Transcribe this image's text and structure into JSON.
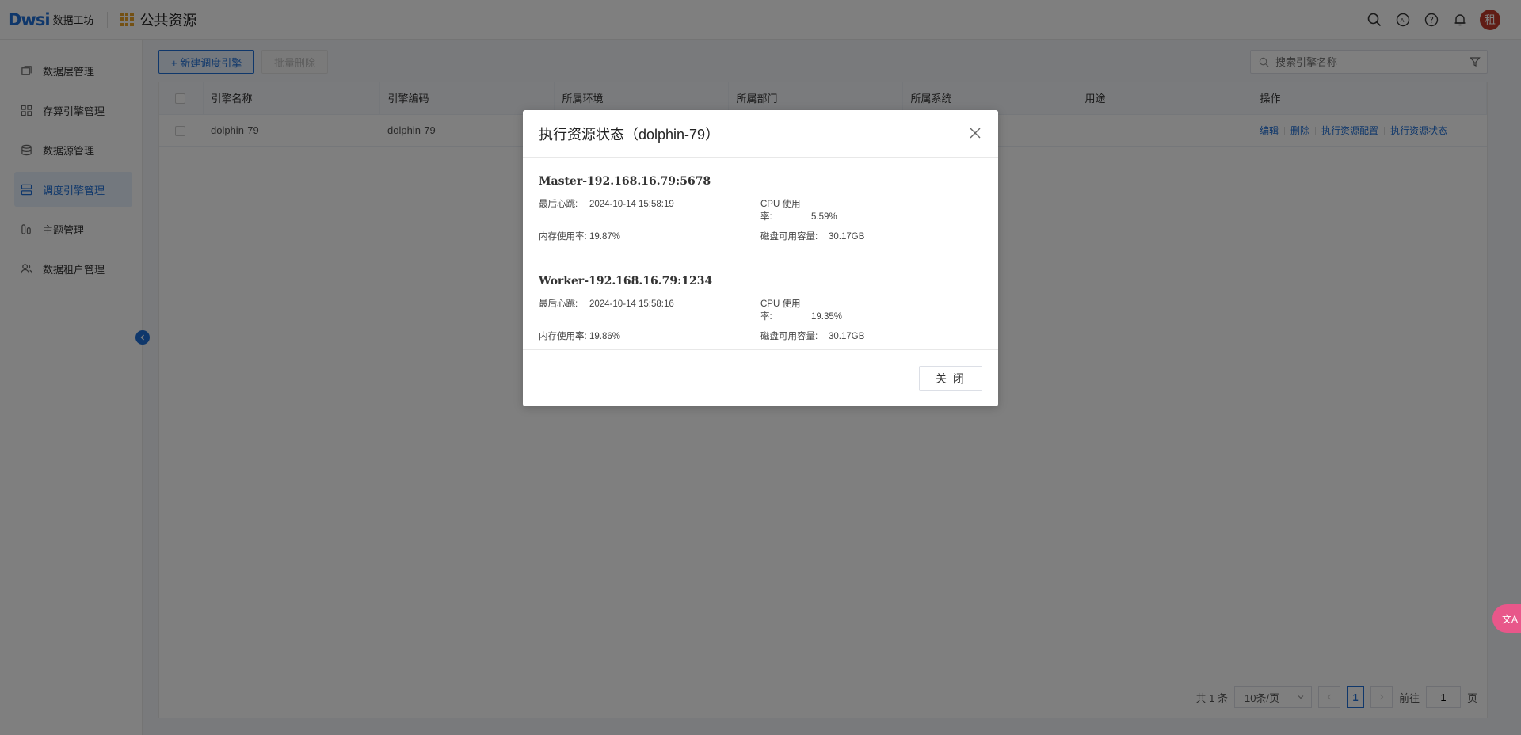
{
  "header": {
    "logo_mark": "Dwsi",
    "logo_text": "数据工坊",
    "app_title": "公共资源",
    "avatar_text": "租",
    "icons": [
      "search-icon",
      "ai-icon",
      "help-icon",
      "bell-icon"
    ]
  },
  "sidebar": {
    "items": [
      {
        "label": "数据层管理",
        "icon": "layers-icon",
        "active": false
      },
      {
        "label": "存算引擎管理",
        "icon": "grid-icon",
        "active": false
      },
      {
        "label": "数据源管理",
        "icon": "database-icon",
        "active": false
      },
      {
        "label": "调度引擎管理",
        "icon": "server-icon",
        "active": true
      },
      {
        "label": "主题管理",
        "icon": "tag-icon",
        "active": false
      },
      {
        "label": "数据租户管理",
        "icon": "users-icon",
        "active": false
      }
    ]
  },
  "toolbar": {
    "new_label": "+ 新建调度引擎",
    "batch_delete_label": "批量删除",
    "search_placeholder": "搜索引擎名称"
  },
  "table": {
    "columns": [
      "引擎名称",
      "引擎编码",
      "所属环境",
      "所属部门",
      "所属系统",
      "用途",
      "操作"
    ],
    "rows": [
      {
        "name": "dolphin-79",
        "code": "dolphin-79",
        "env": "",
        "dept": "",
        "system": "",
        "usage": ""
      }
    ],
    "ops": [
      "编辑",
      "删除",
      "执行资源配置",
      "执行资源状态"
    ]
  },
  "pager": {
    "total": "共 1 条",
    "page_size": "10条/页",
    "current_page": "1",
    "goto_label": "前往",
    "goto_value": "1",
    "page_suffix": "页"
  },
  "modal": {
    "title": "执行资源状态（dolphin-79）",
    "close_label": "关 闭",
    "nodes": [
      {
        "title": "Master-192.168.16.79:5678",
        "heartbeat_label": "最后心跳:",
        "heartbeat": "2024-10-14 15:58:19",
        "cpu_label": "CPU 使用率:",
        "cpu": "5.59%",
        "mem_label": "内存使用率:",
        "mem": "19.87%",
        "disk_label": "磁盘可用容量:",
        "disk": "30.17GB"
      },
      {
        "title": "Worker-192.168.16.79:1234",
        "heartbeat_label": "最后心跳:",
        "heartbeat": "2024-10-14 15:58:16",
        "cpu_label": "CPU 使用率:",
        "cpu": "19.35%",
        "mem_label": "内存使用率:",
        "mem": "19.86%",
        "disk_label": "磁盘可用容量:",
        "disk": "30.17GB"
      }
    ]
  },
  "float_button": {
    "label": "文A"
  },
  "colors": {
    "accent": "#1f6fd6",
    "logo_grid": "#e8a229",
    "avatar": "#c0392b",
    "float": "#e8578a"
  }
}
